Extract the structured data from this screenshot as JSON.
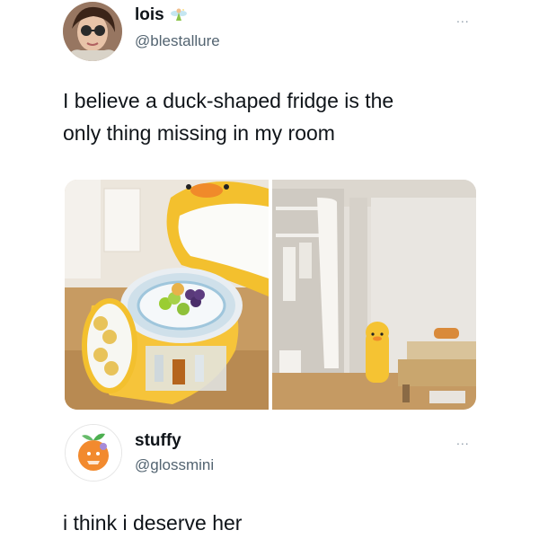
{
  "tweets": [
    {
      "display_name": "lois",
      "handle": "@blestallure",
      "text_line1": "I believe a duck-shaped fridge is the",
      "text_line2": "only thing missing in my room",
      "more": "...",
      "avatar_icon": "profile-photo",
      "badge_icon": "fairy-emoji"
    },
    {
      "display_name": "stuffy",
      "handle": "@glossmini",
      "text_line1": "i think i deserve her",
      "more": "...",
      "avatar_icon": "orange-fruit-illustration"
    }
  ],
  "media": {
    "images": [
      {
        "icon": "duck-fridge-open-photo"
      },
      {
        "icon": "duck-fridge-in-room-photo"
      }
    ]
  },
  "colors": {
    "text": "#0f1419",
    "secondary": "#536471",
    "duck_yellow": "#f5c333",
    "orange": "#f28a2e"
  }
}
